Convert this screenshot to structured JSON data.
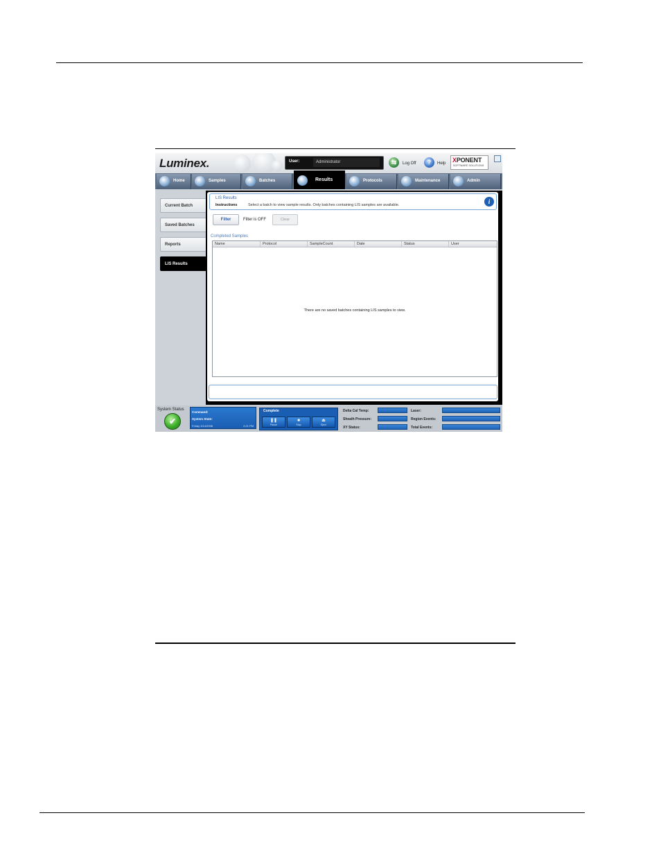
{
  "app": {
    "logo": "Luminex.",
    "user_label": "User:",
    "user_value": "Administrator",
    "logoff_label": "Log Off",
    "help_label": "Help",
    "brand_main": "PONENT",
    "brand_x": "X",
    "brand_sub": "SOFTWARE SOLUTIONS"
  },
  "nav": {
    "tabs": [
      {
        "label": "Home"
      },
      {
        "label": "Samples"
      },
      {
        "label": "Batches"
      },
      {
        "label": "Results",
        "active": true
      },
      {
        "label": "Protocols"
      },
      {
        "label": "Maintenance"
      },
      {
        "label": "Admin"
      }
    ]
  },
  "sidebar": {
    "items": [
      {
        "label": "Current Batch"
      },
      {
        "label": "Saved Batches"
      },
      {
        "label": "Reports"
      },
      {
        "label": "LIS Results",
        "active": true
      }
    ]
  },
  "main": {
    "title": "LIS Results",
    "instructions_label": "Instructions",
    "instructions_text": "Select a batch to view sample results. Only batches containing LIS samples are available.",
    "info_icon": "i",
    "filter_button": "Filter",
    "filter_status": "Filter is OFF",
    "clear_button": "Clear",
    "group_title": "Completed Samples",
    "columns": [
      "Name",
      "Protocol",
      "SampleCount",
      "Date",
      "Status",
      "User"
    ],
    "empty_message": "There are no saved batches containing LIS samples to view."
  },
  "status": {
    "system_status_label": "System Status",
    "ok_glyph": "✔",
    "command_label": "Command:",
    "system_state_label": "System State:",
    "date": "Friday 3/14/2008",
    "time": "2:21 PM",
    "state_title": "Complete",
    "controls": [
      {
        "glyph": "❚❚",
        "label": "Pause"
      },
      {
        "glyph": "■",
        "label": "Stop"
      },
      {
        "glyph": "⏏",
        "label": "Eject"
      }
    ],
    "delta_cal_temp_label": "Delta Cal Temp:",
    "sheath_pressure_label": "Sheath Pressure:",
    "xy_status_label": "XY Status:",
    "laser_label": "Laser:",
    "region_events_label": "Region Events:",
    "total_events_label": "Total Events:"
  },
  "colors": {
    "accent_blue": "#1a5eb3",
    "title_blue": "#2f5fa8",
    "ok_green": "#3cae2a"
  }
}
